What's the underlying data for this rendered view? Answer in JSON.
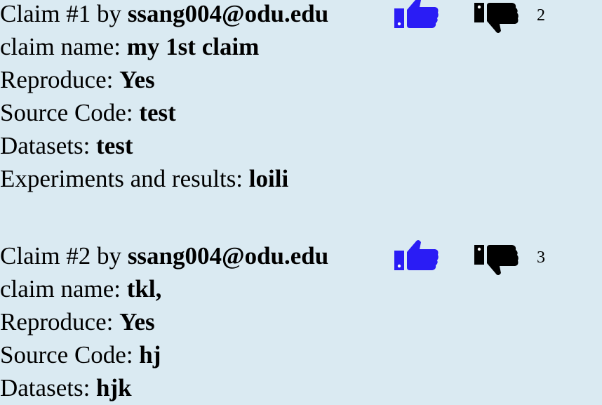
{
  "colors": {
    "background": "#daeaf2",
    "like": "#2a1cf5",
    "dislike": "#000000"
  },
  "claims": [
    {
      "header_prefix": "Claim #1 by ",
      "author": "ssang004@odu.edu",
      "count": "2",
      "fields": [
        {
          "label": "claim name: ",
          "value": "my 1st claim"
        },
        {
          "label": "Reproduce: ",
          "value": "Yes"
        },
        {
          "label": "Source Code: ",
          "value": "test"
        },
        {
          "label": "Datasets: ",
          "value": "test"
        },
        {
          "label": "Experiments and results: ",
          "value": "loili"
        }
      ]
    },
    {
      "header_prefix": "Claim #2 by ",
      "author": "ssang004@odu.edu",
      "count": "3",
      "fields": [
        {
          "label": "claim name: ",
          "value": "tkl,"
        },
        {
          "label": "Reproduce: ",
          "value": "Yes"
        },
        {
          "label": "Source Code: ",
          "value": "hj"
        },
        {
          "label": "Datasets: ",
          "value": "hjk"
        }
      ]
    }
  ],
  "icons": {
    "like": "thumbs-up-icon",
    "dislike": "thumbs-down-icon"
  }
}
